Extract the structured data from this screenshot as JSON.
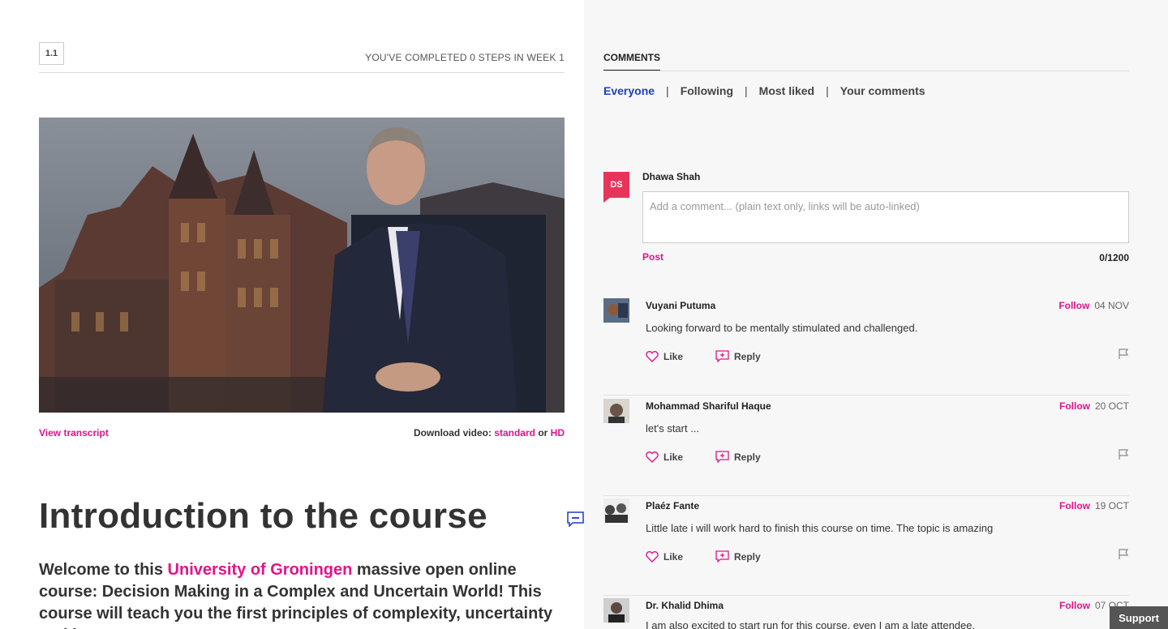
{
  "step": {
    "number": "1.1",
    "progress_text": "YOU'VE COMPLETED 0 STEPS IN WEEK 1"
  },
  "video": {
    "transcript_link": "View transcript",
    "download_label": "Download video:",
    "standard_link": "standard",
    "or_text": "or",
    "hd_link": "HD"
  },
  "article": {
    "title": "Introduction to the course",
    "intro_before": "Welcome to this ",
    "intro_link": "University of Groningen",
    "intro_after": " massive open online course: Decision Making in a Complex and Uncertain World! This course will teach you the first principles of complexity, uncertainty and how to"
  },
  "comments": {
    "heading": "COMMENTS",
    "filters": [
      "Everyone",
      "Following",
      "Most liked",
      "Your comments"
    ],
    "separator": "|",
    "current_user": {
      "initials": "DS",
      "name": "Dhawa Shah"
    },
    "input_placeholder": "Add a comment... (plain text only, links will be auto-linked)",
    "post_label": "Post",
    "counter": "0/1200",
    "like_label": "Like",
    "reply_label": "Reply",
    "follow_label": "Follow",
    "items": [
      {
        "author": "Vuyani Putuma",
        "date": "04 NOV",
        "text": "Looking forward to be mentally stimulated and challenged."
      },
      {
        "author": "Mohammad Shariful Haque",
        "date": "20 OCT",
        "text": "let's start ..."
      },
      {
        "author": "Plaéz Fante",
        "date": "19 OCT",
        "text": "Little late i will work hard to finish this course on time. The topic is amazing"
      },
      {
        "author": "Dr. Khalid Dhima",
        "date": "07 OCT",
        "text": "I am also excited to start run for this course, even I am a late attendee."
      }
    ]
  },
  "support_label": "Support",
  "colors": {
    "accent": "#e2148a",
    "active_filter": "#1d3fbb",
    "avatar": "#e8345a"
  }
}
